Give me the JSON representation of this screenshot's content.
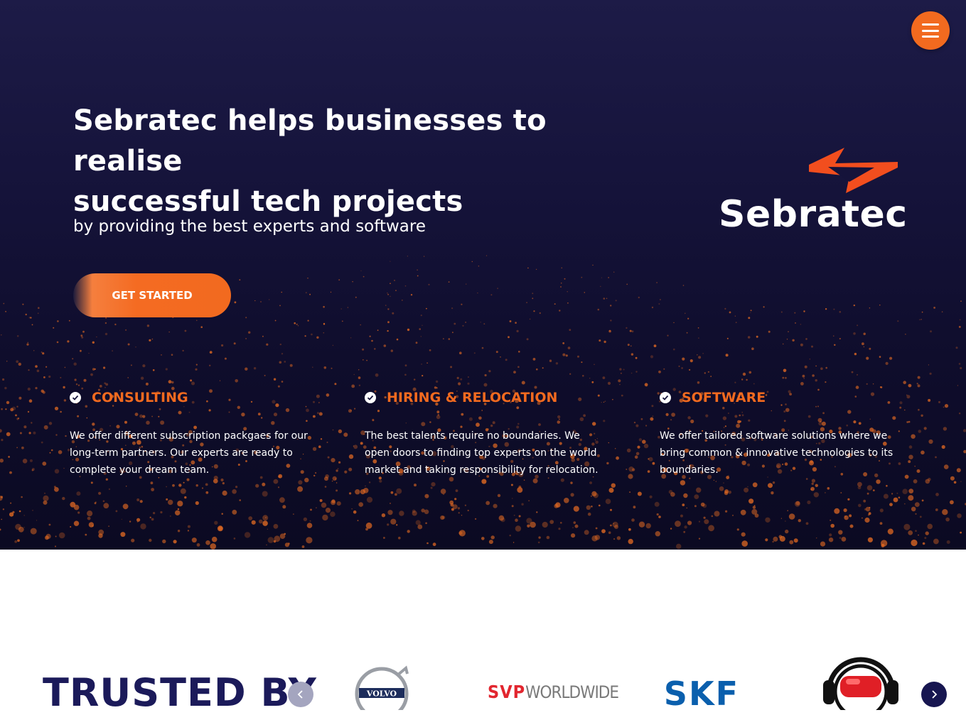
{
  "hero": {
    "headline_line1": "Sebratec helps businesses to realise",
    "headline_line2": "successful tech projects",
    "subheadline": "by providing the best experts and software",
    "cta_label": "GET STARTED",
    "menu_icon": "hamburger-menu-icon",
    "logo_text": "Sebratec"
  },
  "features": [
    {
      "icon": "check-circle-icon",
      "title": "CONSULTING",
      "description": "We offer different subscription packgaes for our long-term partners. Our experts are ready to complete your dream team."
    },
    {
      "icon": "check-circle-icon",
      "title": "HIRING & RELOCATION",
      "description": "The best talents require no boundaries. We open doors to finding top experts on the world market and taking responsibility for relocation."
    },
    {
      "icon": "check-circle-icon",
      "title": "SOFTWARE",
      "description": "We offer tailored software solutions where we bring common & innovative technologies to its boundaries."
    }
  ],
  "trusted": {
    "heading": "TRUSTED BY",
    "prev_icon": "chevron-left-icon",
    "next_icon": "chevron-right-icon",
    "logos": {
      "volvo": "VOLVO",
      "svp_bold": "SVP",
      "svp_light": "WORLDWIDE",
      "skf": "SKF"
    }
  },
  "colors": {
    "accent": "#f26a1f",
    "navy": "#1b1a5a",
    "hero_bg": "#15133a"
  }
}
